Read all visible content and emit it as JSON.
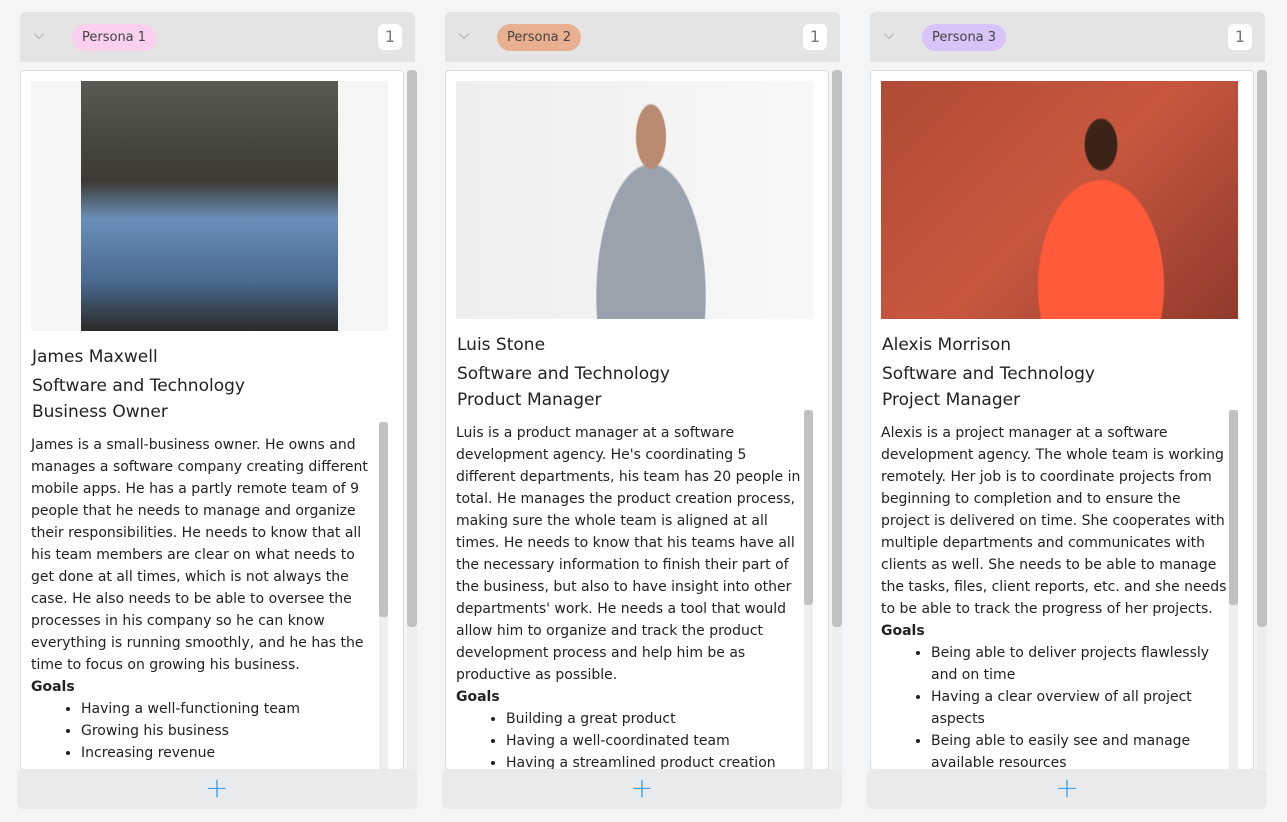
{
  "columns": [
    {
      "tag": "Persona 1",
      "tag_color": "#fbd0ee",
      "count": "1",
      "name": "James Maxwell",
      "industry": "Software and Technology",
      "role": "Business Owner",
      "description": "James is a small-business owner. He owns and manages a software company creating different mobile apps. He has a partly remote team of 9 people that he needs to manage and organize their responsibilities. He needs to know that all his team members are clear on what needs to get done at all times, which is not always the case. He also needs to be able to oversee the processes in his company so he can know everything is running smoothly, and he has the time to focus on growing his business.",
      "goals_label": "Goals",
      "goals": [
        "Having a well-functioning team",
        "Growing his business",
        "Increasing revenue"
      ],
      "add": "+"
    },
    {
      "tag": "Persona 2",
      "tag_color": "#e8b090",
      "count": "1",
      "name": "Luis Stone",
      "industry": "Software and Technology",
      "role": "Product Manager",
      "description": "Luis is a product manager at a software development agency. He's coordinating 5 different departments, his team has 20 people in total. He manages the product creation process, making sure the whole team is aligned at all times. He needs to know that his teams have all the necessary information to finish their part of the business, but also to have insight into other departments' work. He needs a tool that would allow him to organize and track the product development process and help him be as productive as possible.",
      "goals_label": "Goals",
      "goals": [
        "Building a great product",
        "Having a well-coordinated team",
        "Having a streamlined product creation"
      ],
      "add": "+"
    },
    {
      "tag": "Persona 3",
      "tag_color": "#d8c4f8",
      "count": "1",
      "name": "Alexis Morrison",
      "industry": "Software and Technology",
      "role": "Project Manager",
      "description": "Alexis is a project manager at a software development agency. The whole team is working remotely. Her job is to coordinate projects from beginning to completion and to ensure the project is delivered on time. She cooperates with multiple departments and communicates with clients as well. She needs to be able to manage the tasks, files, client reports, etc. and she needs to be able to track the progress of her projects.",
      "goals_label": "Goals",
      "goals": [
        "Being able to deliver projects flawlessly and on time",
        "Having a clear overview of all project aspects",
        "Being able to easily see and manage available resources"
      ],
      "add": "+"
    }
  ]
}
